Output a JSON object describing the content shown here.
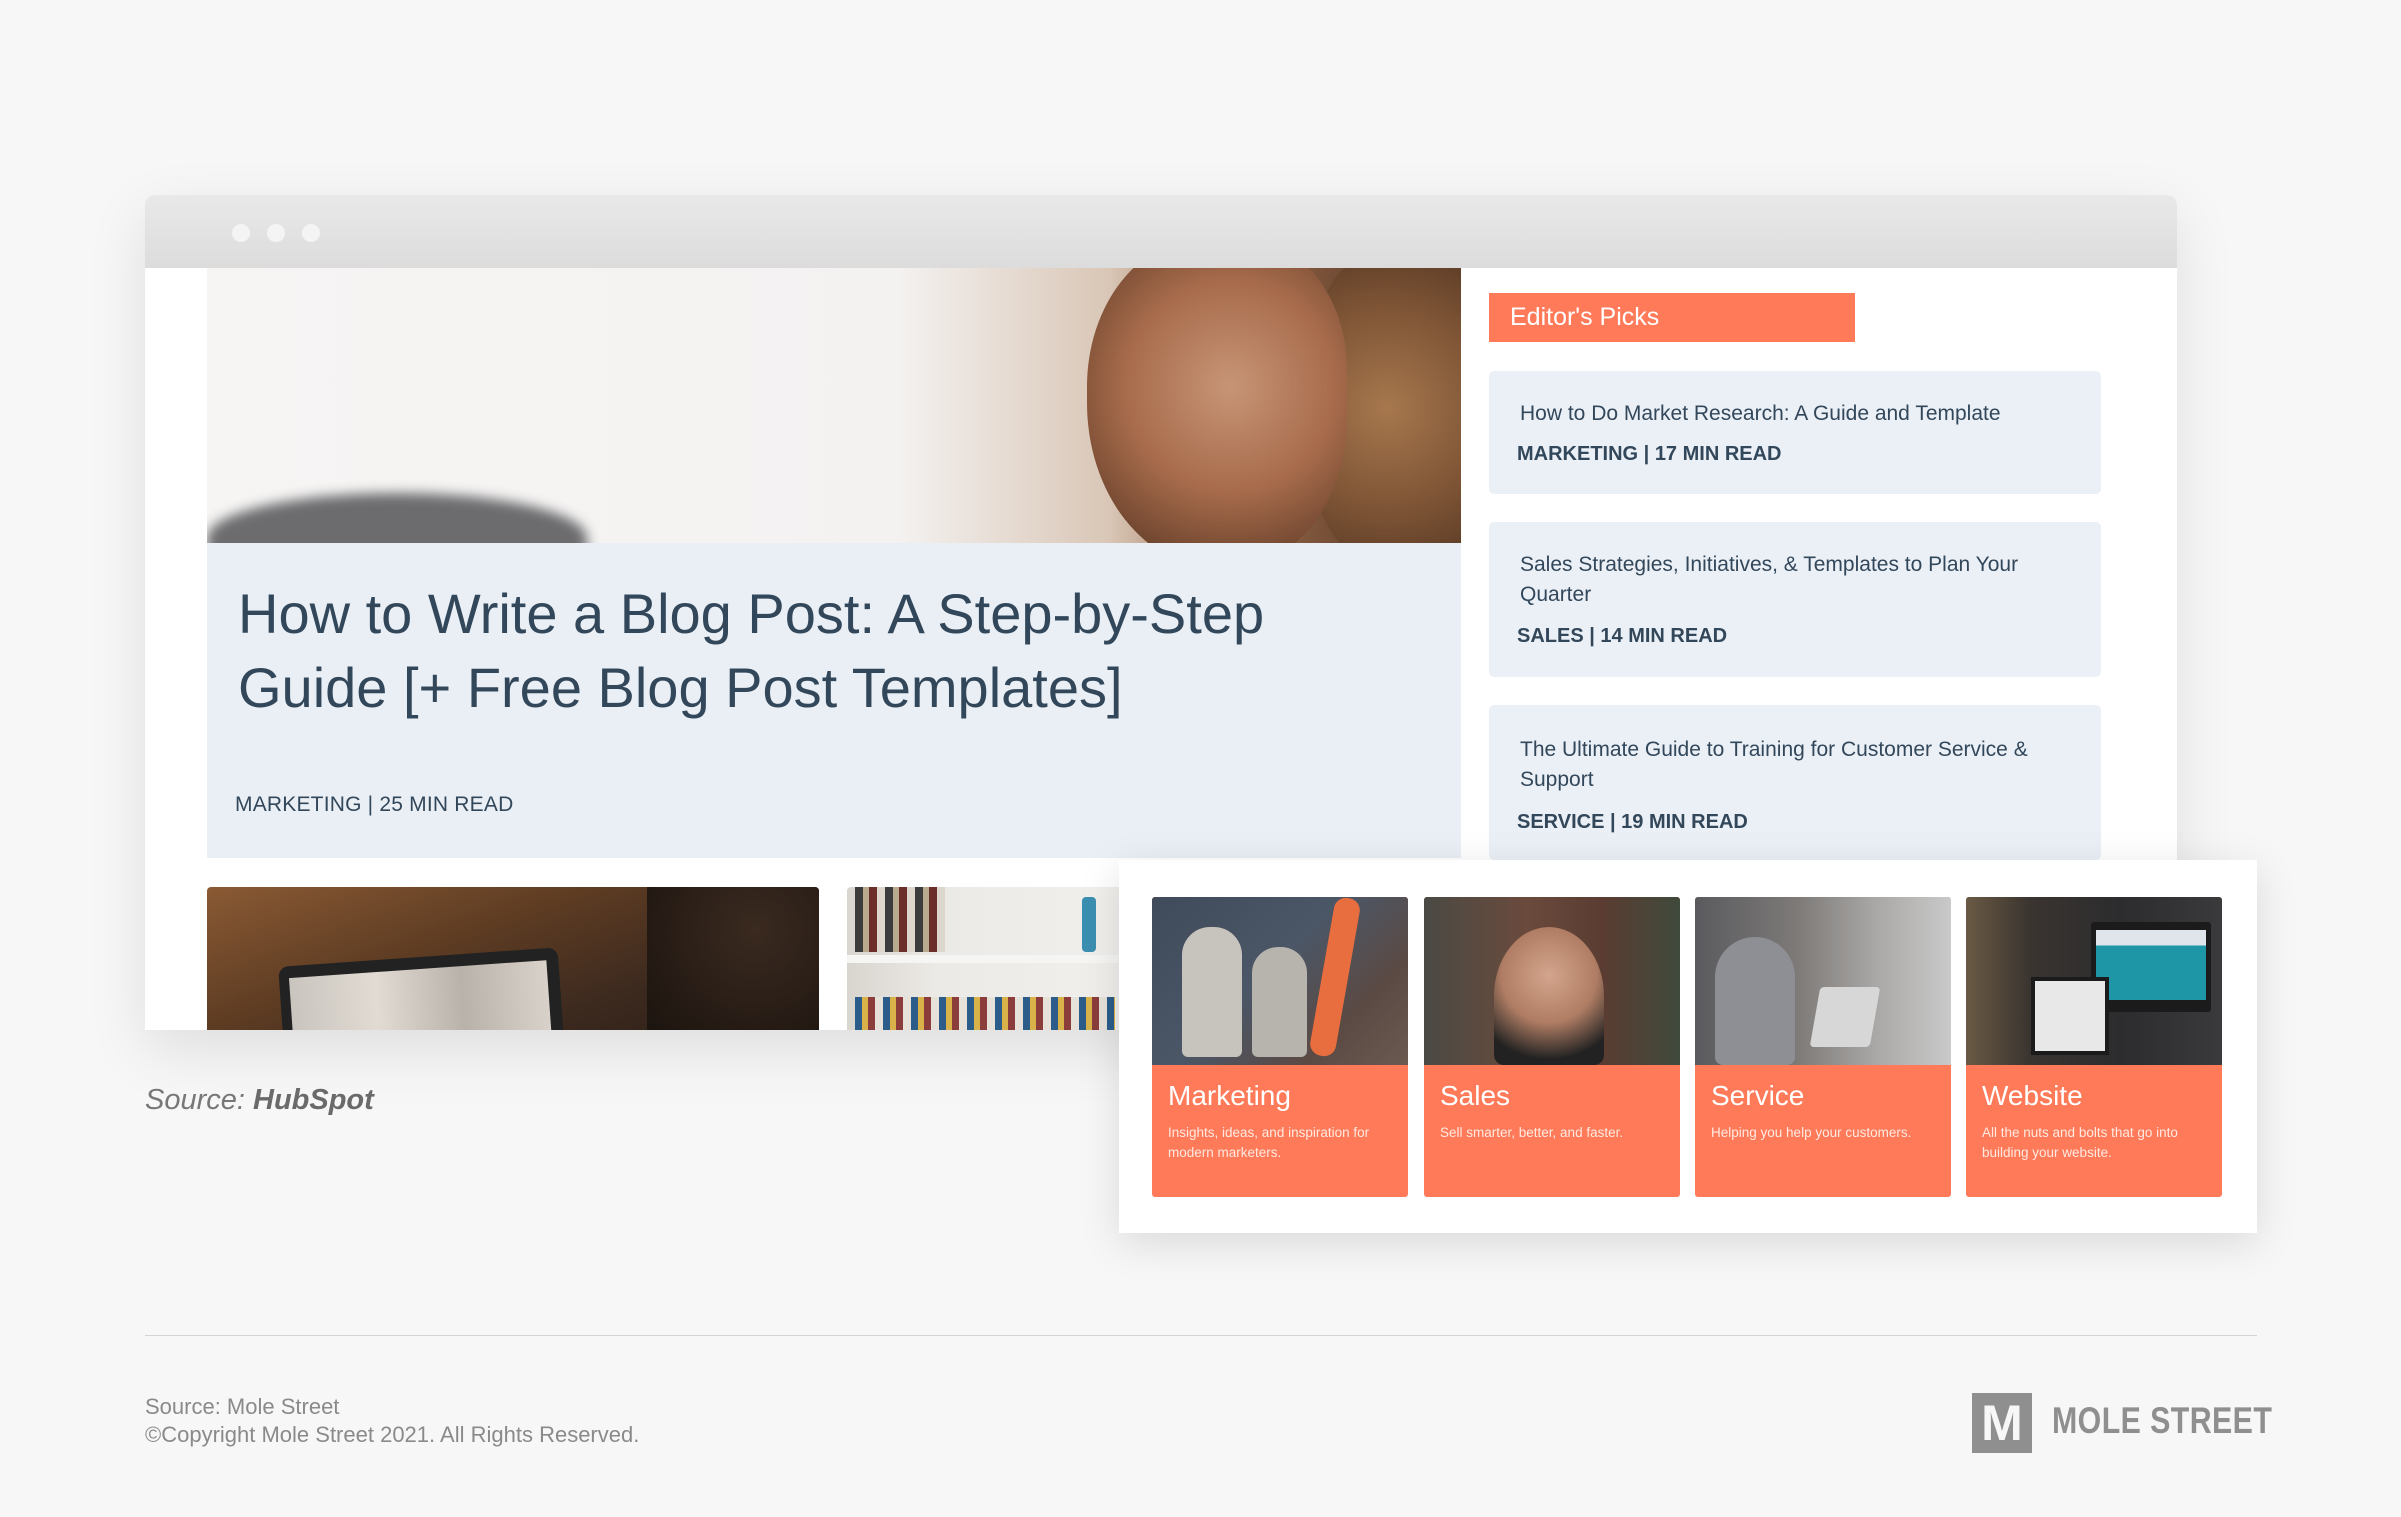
{
  "browser": {
    "window_controls": [
      "window-dot",
      "window-dot",
      "window-dot"
    ]
  },
  "featured_post": {
    "title": "How to Write a Blog Post: A Step-by-Step Guide [+ Free Blog Post Templates]",
    "meta": "MARKETING | 25 MIN READ"
  },
  "editors_picks": {
    "header": "Editor's Picks",
    "items": [
      {
        "title": "How to Do Market Research: A Guide and Template",
        "meta": "MARKETING | 17 MIN READ"
      },
      {
        "title": "Sales Strategies, Initiatives, & Templates to Plan Your Quarter",
        "meta": "SALES | 14 MIN READ"
      },
      {
        "title": "The Ultimate Guide to Training for Customer Service & Support",
        "meta": "SERVICE | 19 MIN READ"
      }
    ]
  },
  "categories": [
    {
      "title": "Marketing",
      "description": "Insights, ideas, and inspiration for modern marketers."
    },
    {
      "title": "Sales",
      "description": "Sell smarter, better, and faster."
    },
    {
      "title": "Service",
      "description": "Helping you help your customers."
    },
    {
      "title": "Website",
      "description": "All the nuts and bolts that go into building your website."
    }
  ],
  "caption": {
    "prefix": "Source: ",
    "source": "HubSpot"
  },
  "footer": {
    "source": "Source: Mole Street",
    "copyright": "©Copyright Mole Street 2021. All Rights Reserved.",
    "logo_mark": "M",
    "logo_text": "MOLE STREET"
  },
  "colors": {
    "accent": "#ff7a59",
    "card_bg": "#eaf0f6",
    "text_dark": "#33475b"
  }
}
